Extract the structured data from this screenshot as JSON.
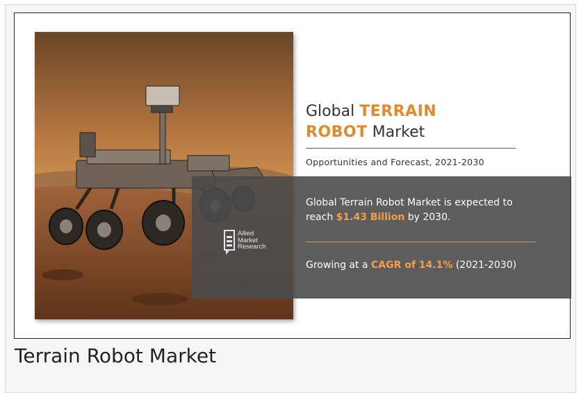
{
  "figure": {
    "title_prefix": "Global ",
    "title_bold_1": "TERRAIN",
    "title_bold_2": "ROBOT",
    "title_suffix": " Market",
    "subtitle": "Opportunities and Forecast, 2021-2030",
    "info_line1": "Global Terrain Robot Market is expected to",
    "info_line2_prefix": "reach ",
    "info_value": "$1.43 Billion",
    "info_line2_suffix": " by 2030.",
    "growth_prefix": "Growing at a ",
    "growth_value": "CAGR of 14.1%",
    "growth_suffix": " (2021-2030)",
    "logo_line1": "Allied",
    "logo_line2": "Market",
    "logo_line3": "Research",
    "image_subject": "mars-rover-illustration"
  },
  "caption": "Terrain Robot Market",
  "colors": {
    "accent": "#e08a2c",
    "panel": "#4b4b4b",
    "highlight": "#f0a04b"
  }
}
